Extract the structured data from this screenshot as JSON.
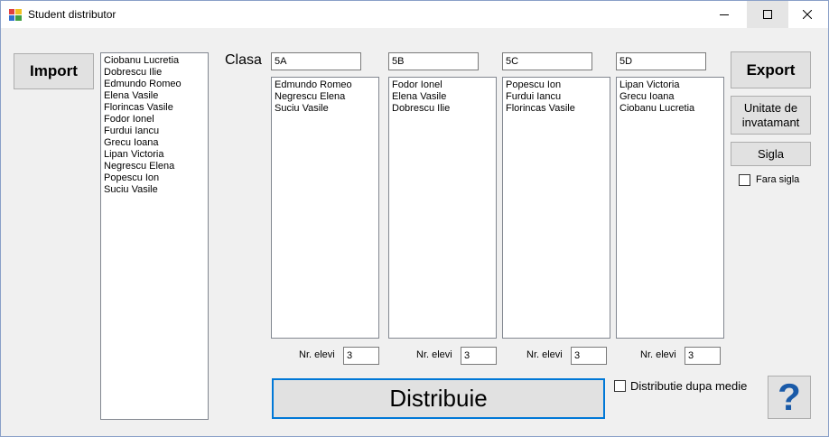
{
  "window": {
    "title": "Student distributor"
  },
  "buttons": {
    "import": "Import",
    "export": "Export",
    "unitate": "Unitate de invatamant",
    "sigla": "Sigla",
    "distribuie": "Distribuie",
    "help": "?"
  },
  "source_list": [
    "Ciobanu Lucretia",
    "Dobrescu Ilie",
    "Edmundo Romeo",
    "Elena Vasile",
    "Florincas Vasile",
    "Fodor Ionel",
    "Furdui Iancu",
    "Grecu Ioana",
    "Lipan Victoria",
    "Negrescu Elena",
    "Popescu Ion",
    "Suciu Vasile"
  ],
  "clasa_label": "Clasa",
  "nr_elevi_label": "Nr. elevi",
  "classes": [
    {
      "name": "5A",
      "students": [
        "Edmundo Romeo",
        "Negrescu Elena",
        "Suciu Vasile"
      ],
      "count": "3"
    },
    {
      "name": "5B",
      "students": [
        "Fodor Ionel",
        "Elena Vasile",
        "Dobrescu Ilie"
      ],
      "count": "3"
    },
    {
      "name": "5C",
      "students": [
        "Popescu Ion",
        "Furdui Iancu",
        "Florincas Vasile"
      ],
      "count": "3"
    },
    {
      "name": "5D",
      "students": [
        "Lipan Victoria",
        "Grecu Ioana",
        "Ciobanu Lucretia"
      ],
      "count": "3"
    }
  ],
  "checkboxes": {
    "fara_sigla": {
      "label": "Fara sigla",
      "checked": false
    },
    "distributie": {
      "label": "Distributie dupa medie",
      "checked": false
    }
  },
  "colors": {
    "accent": "#0078d7",
    "button_face": "#e1e1e1",
    "help_icon": "#1a5aa8"
  },
  "icons": [
    "app-icon",
    "minimize-icon",
    "maximize-icon",
    "close-icon",
    "help-icon"
  ]
}
